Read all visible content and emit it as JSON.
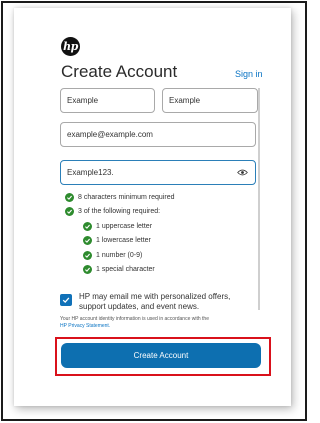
{
  "header": {
    "logo_text": "hp",
    "title": "Create Account",
    "sign_in_link": "Sign in"
  },
  "form": {
    "first_name_value": "Example",
    "last_name_value": "Example",
    "email_value": "example@example.com",
    "password_value": "Example123."
  },
  "requirements": {
    "min_chars": "8 characters minimum required",
    "of_following": "3 of the following required:",
    "uppercase": "1 uppercase letter",
    "lowercase": "1 lowercase letter",
    "number": "1 number (0-9)",
    "special": "1 special character"
  },
  "consent": {
    "text": "HP may email me with personalized offers, support updates, and event news.",
    "checked": true
  },
  "privacy": {
    "text": "Your HP account identity information is used in accordance with the",
    "link": "HP Privacy Statement."
  },
  "submit": {
    "label": "Create Account"
  },
  "colors": {
    "accent": "#0d6fb0",
    "check_green": "#2e8b2e",
    "highlight_red": "#d9111b"
  }
}
